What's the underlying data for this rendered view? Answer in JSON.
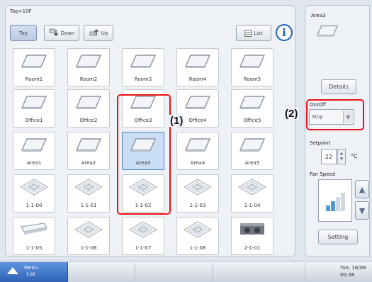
{
  "breadcrumb": "Top>10F",
  "nav": {
    "top_label": "Top",
    "down_label": "Down",
    "up_label": "Up",
    "list_label": "List",
    "info_symbol": "i"
  },
  "tiles": [
    {
      "label": "Room1",
      "icon": "area-icon"
    },
    {
      "label": "Room2",
      "icon": "area-icon"
    },
    {
      "label": "Room3",
      "icon": "area-icon"
    },
    {
      "label": "Room4",
      "icon": "area-icon"
    },
    {
      "label": "Room5",
      "icon": "area-icon"
    },
    {
      "label": "Office1",
      "icon": "area-icon"
    },
    {
      "label": "Office2",
      "icon": "area-icon"
    },
    {
      "label": "Office3",
      "icon": "area-icon"
    },
    {
      "label": "Office4",
      "icon": "area-icon"
    },
    {
      "label": "Office5",
      "icon": "area-icon"
    },
    {
      "label": "Area1",
      "icon": "area-icon"
    },
    {
      "label": "Area2",
      "icon": "area-icon"
    },
    {
      "label": "Area3",
      "icon": "area-icon",
      "selected": true
    },
    {
      "label": "Area4",
      "icon": "area-icon"
    },
    {
      "label": "Area5",
      "icon": "area-icon"
    },
    {
      "label": "1-1-00",
      "icon": "cassette-unit-icon"
    },
    {
      "label": "1-1-01",
      "icon": "cassette-unit-icon"
    },
    {
      "label": "1-1-02",
      "icon": "cassette-unit-icon"
    },
    {
      "label": "1-1-03",
      "icon": "cassette-unit-icon"
    },
    {
      "label": "1-1-04",
      "icon": "cassette-unit-icon"
    },
    {
      "label": "1-1-05",
      "icon": "wall-unit-icon"
    },
    {
      "label": "1-1-06",
      "icon": "cassette-unit-icon"
    },
    {
      "label": "1-1-07",
      "icon": "cassette-unit-icon"
    },
    {
      "label": "1-1-08",
      "icon": "cassette-unit-icon"
    },
    {
      "label": "2-1-01",
      "icon": "duct-unit-icon"
    }
  ],
  "callouts": {
    "first": "(1)",
    "second": "(2)"
  },
  "detail": {
    "area_title": "Area3",
    "details_label": "Details",
    "onoff_label": "On/Off",
    "onoff_value": "Stop",
    "setpoint_label": "Setpoint",
    "setpoint_value": "22",
    "setpoint_unit": "°C",
    "fan_speed_label": "Fan Speed",
    "setting_label": "Setting"
  },
  "taskbar": {
    "menu_label": "Menu\nList",
    "datetime": "Tue, 16/08\n00:38"
  },
  "colors": {
    "accent": "#2d5fb3",
    "callout": "#e11111",
    "selected_tile": "#c9ddf4"
  }
}
